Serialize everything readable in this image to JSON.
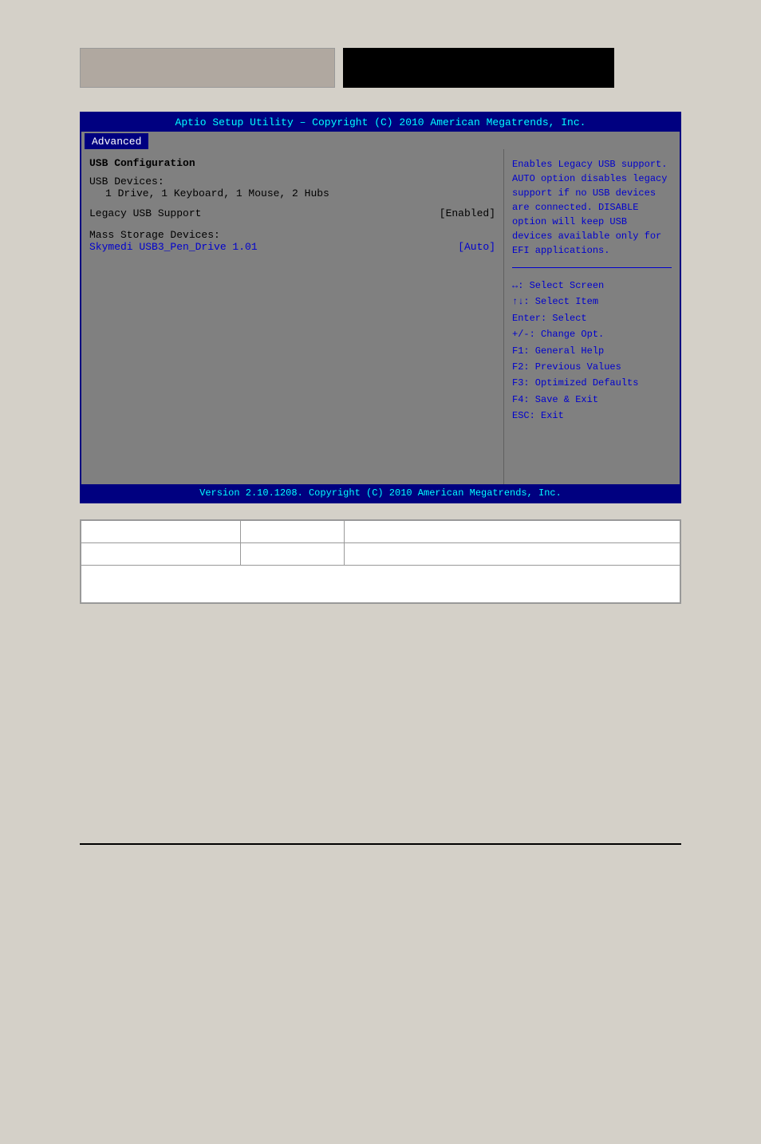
{
  "header": {
    "left_label": "",
    "right_label": ""
  },
  "bios": {
    "title": "Aptio Setup Utility – Copyright (C) 2010 American Megatrends, Inc.",
    "active_tab": "Advanced",
    "left": {
      "section_title": "USB Configuration",
      "devices_label": "USB Devices:",
      "devices_value": "1 Drive, 1 Keyboard, 1 Mouse, 2 Hubs",
      "legacy_usb_label": "Legacy USB Support",
      "legacy_usb_value": "[Enabled]",
      "mass_storage_label": "Mass Storage Devices:",
      "mass_storage_item": "Skymedi USB3_Pen_Drive 1.01",
      "mass_storage_item_value": "[Auto]"
    },
    "right": {
      "help_text": "Enables Legacy USB support. AUTO option disables legacy support if no USB devices are connected. DISABLE option will keep USB devices available only for EFI applications.",
      "shortcuts": [
        "↔: Select Screen",
        "↑↓: Select Item",
        "Enter: Select",
        "+/-: Change Opt.",
        "F1: General Help",
        "F2: Previous Values",
        "F3: Optimized Defaults",
        "F4: Save & Exit",
        "ESC: Exit"
      ]
    },
    "footer": "Version 2.10.1208. Copyright (C) 2010 American Megatrends, Inc."
  },
  "info_table": {
    "rows": [
      {
        "col1": "",
        "col2": "",
        "col3": ""
      },
      {
        "col1": "",
        "col2": "",
        "col3": ""
      }
    ],
    "note": ""
  }
}
